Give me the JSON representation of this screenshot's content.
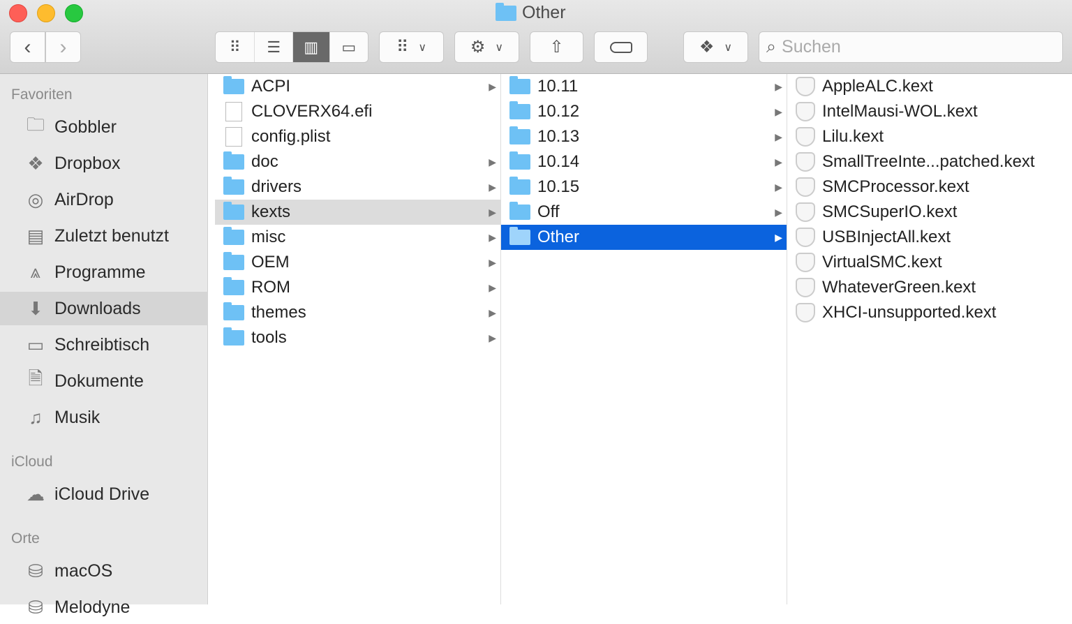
{
  "window": {
    "title": "Other"
  },
  "toolbar": {
    "search_placeholder": "Suchen"
  },
  "sidebar": {
    "sections": [
      {
        "header": "Favoriten",
        "items": [
          {
            "label": "Gobbler",
            "icon": "folder-icon"
          },
          {
            "label": "Dropbox",
            "icon": "dropbox-icon"
          },
          {
            "label": "AirDrop",
            "icon": "airdrop-icon"
          },
          {
            "label": "Zuletzt benutzt",
            "icon": "recents-icon"
          },
          {
            "label": "Programme",
            "icon": "applications-icon"
          },
          {
            "label": "Downloads",
            "icon": "downloads-icon",
            "selected": true
          },
          {
            "label": "Schreibtisch",
            "icon": "desktop-icon"
          },
          {
            "label": "Dokumente",
            "icon": "documents-icon"
          },
          {
            "label": "Musik",
            "icon": "music-icon"
          }
        ]
      },
      {
        "header": "iCloud",
        "items": [
          {
            "label": "iCloud Drive",
            "icon": "cloud-icon"
          }
        ]
      },
      {
        "header": "Orte",
        "items": [
          {
            "label": "macOS",
            "icon": "disk-icon"
          },
          {
            "label": "Melodyne",
            "icon": "disk-icon"
          }
        ]
      }
    ]
  },
  "columns": [
    [
      {
        "n": "ACPI",
        "t": "folder",
        "a": 1
      },
      {
        "n": "CLOVERX64.efi",
        "t": "file"
      },
      {
        "n": "config.plist",
        "t": "plist"
      },
      {
        "n": "doc",
        "t": "folder",
        "a": 1
      },
      {
        "n": "drivers",
        "t": "folder",
        "a": 1
      },
      {
        "n": "kexts",
        "t": "folder",
        "a": 1,
        "s": "grey"
      },
      {
        "n": "misc",
        "t": "folder",
        "a": 1
      },
      {
        "n": "OEM",
        "t": "folder",
        "a": 1
      },
      {
        "n": "ROM",
        "t": "folder",
        "a": 1
      },
      {
        "n": "themes",
        "t": "folder",
        "a": 1
      },
      {
        "n": "tools",
        "t": "folder",
        "a": 1
      }
    ],
    [
      {
        "n": "10.11",
        "t": "folder",
        "a": 1
      },
      {
        "n": "10.12",
        "t": "folder",
        "a": 1
      },
      {
        "n": "10.13",
        "t": "folder",
        "a": 1
      },
      {
        "n": "10.14",
        "t": "folder",
        "a": 1
      },
      {
        "n": "10.15",
        "t": "folder",
        "a": 1
      },
      {
        "n": "Off",
        "t": "folder",
        "a": 1
      },
      {
        "n": "Other",
        "t": "folder",
        "a": 1,
        "s": "blue"
      }
    ],
    [
      {
        "n": "AppleALC.kext",
        "t": "kext"
      },
      {
        "n": "IntelMausi-WOL.kext",
        "t": "kext"
      },
      {
        "n": "Lilu.kext",
        "t": "kext"
      },
      {
        "n": "SmallTreeInte...patched.kext",
        "t": "kext"
      },
      {
        "n": "SMCProcessor.kext",
        "t": "kext"
      },
      {
        "n": "SMCSuperIO.kext",
        "t": "kext"
      },
      {
        "n": "USBInjectAll.kext",
        "t": "kext"
      },
      {
        "n": "VirtualSMC.kext",
        "t": "kext"
      },
      {
        "n": "WhateverGreen.kext",
        "t": "kext"
      },
      {
        "n": "XHCI-unsupported.kext",
        "t": "kext"
      }
    ]
  ]
}
